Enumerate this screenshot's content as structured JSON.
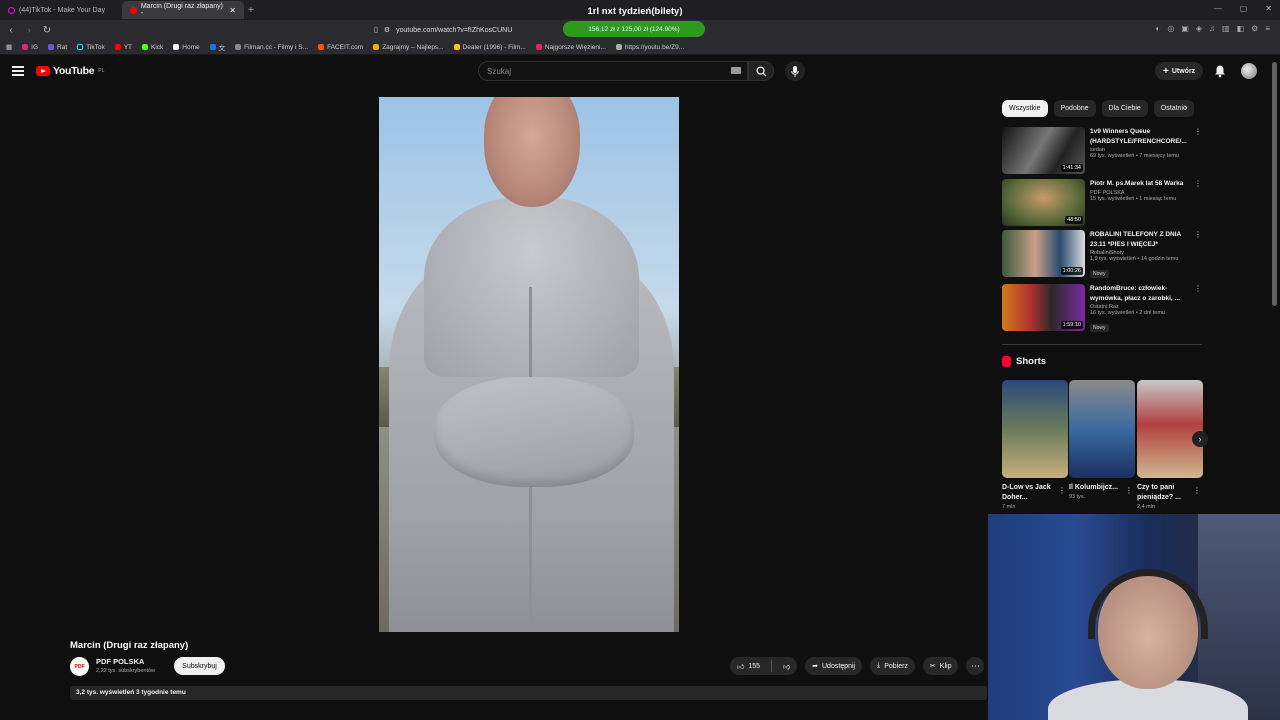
{
  "browser": {
    "tabs": [
      {
        "label": "(44)TikTok - Make Your Day",
        "active": false
      },
      {
        "label": "Marcin (Drugi raz złapany) -",
        "active": true
      }
    ],
    "url": "youtube.com/watch?v=fIZhKosCUNU",
    "promo_title": "1rl nxt tydzień(bilety)",
    "promo_bar": "156,12 zł z 125,00 zł (124.90%)",
    "bookmarks": [
      "IG",
      "Rat",
      "TikTok",
      "YT",
      "Kick",
      "Home",
      "文",
      "Filman.cc - Filmy i S...",
      "FACEIT.com",
      "Zagrajmy – Najleps...",
      "Dealer (1996) - Film...",
      "Najgorsze Więzieni...",
      "https://youtu.be/Z9..."
    ]
  },
  "header": {
    "logo": "YouTube",
    "region": "PL",
    "search_placeholder": "Szukaj",
    "create_label": "Utwórz"
  },
  "video": {
    "title": "Marcin (Drugi raz złapany)",
    "channel": "PDF POLSKA",
    "channel_avatar_text": "PDF",
    "subscribers": "2,22 tys. subskrybentów",
    "subscribe_label": "Subskrybuj",
    "likes": "155",
    "share_label": "Udostępnij",
    "download_label": "Pobierz",
    "clip_label": "Klip",
    "views_date": "3,2 tys. wyświetleń  3 tygodnie temu"
  },
  "sidebar": {
    "chips": [
      "Wszystkie",
      "Podobne",
      "Dla Ciebie",
      "Ostatnio"
    ],
    "recommendations": [
      {
        "title": "1v9 Winners Queue (HARDSTYLE/FRENCHCORE/...",
        "channel": "sedan",
        "meta": "69 tys. wyświetleń • 7 miesięcy temu",
        "duration": "1:41:34",
        "badge": ""
      },
      {
        "title": "Piotr M. ps.Marek lat 58 Warka",
        "channel": "PDF POLSKA",
        "meta": "15 tys. wyświetleń • 1 miesiąc temu",
        "duration": "48:50",
        "badge": ""
      },
      {
        "title": "ROBALINI TELEFONY Z DNIA 23.11 *PIES I WIĘCEJ*",
        "channel": "RobaliniShoty",
        "meta": "1,9 tys. wyświetleń • 14 godzin temu",
        "duration": "1:00:26",
        "badge": "Nowy"
      },
      {
        "title": "RandomBruce: człowiek-wymówka, płacz o zarobki, ...",
        "channel": "Ostatni Raz",
        "meta": "16 tys. wyświetleń • 2 dni temu",
        "duration": "1:59:10",
        "badge": "Nowy"
      }
    ],
    "shorts_heading": "Shorts",
    "shorts": [
      {
        "title": "D-Low vs Jack Doher...",
        "views": "7 mln"
      },
      {
        "title": "Il Kolumbijcz...",
        "views": "93 tys."
      },
      {
        "title": "Czy to pani pieniądze? ...",
        "views": "2,4 mln"
      }
    ]
  }
}
